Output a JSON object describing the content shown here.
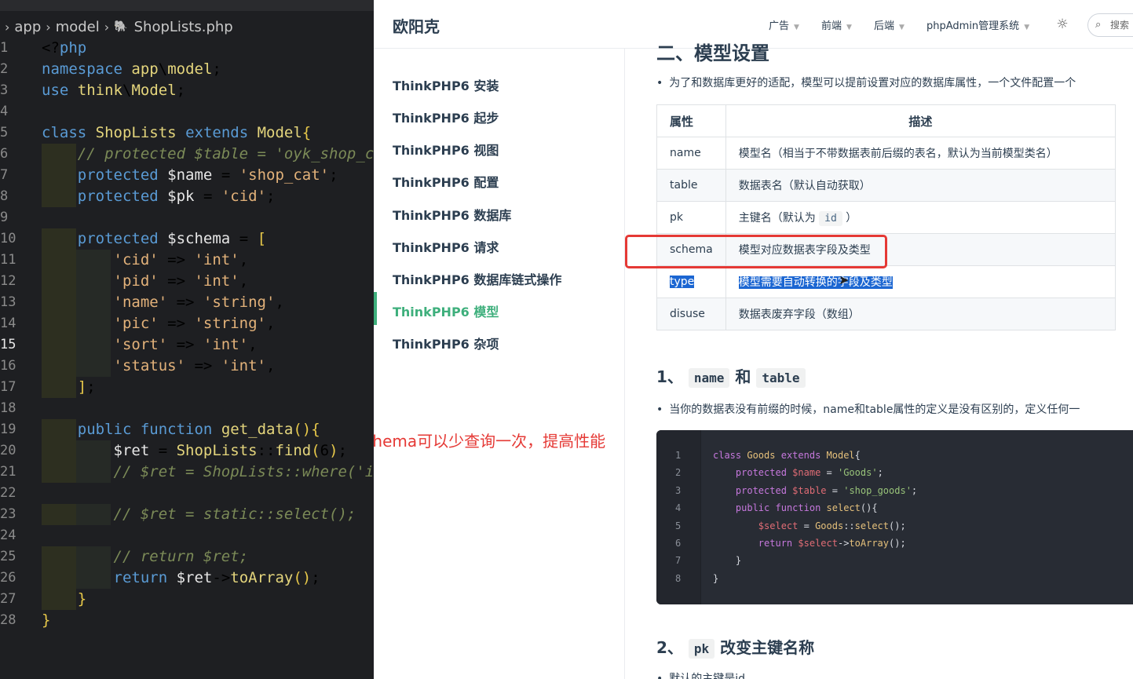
{
  "editor": {
    "breadcrumb": [
      "app",
      "model",
      "ShopLists.php"
    ],
    "active_line": 15,
    "lines": [
      {
        "n": "1",
        "code": "<?php"
      },
      {
        "n": "2",
        "code": "namespace app\\model;"
      },
      {
        "n": "3",
        "code": "use think\\Model;"
      },
      {
        "n": "4",
        "code": ""
      },
      {
        "n": "5",
        "code": "class ShopLists extends Model{"
      },
      {
        "n": "6",
        "code": "    // protected $table = 'oyk_shop_ca"
      },
      {
        "n": "7",
        "code": "    protected $name = 'shop_cat';"
      },
      {
        "n": "8",
        "code": "    protected $pk = 'cid';"
      },
      {
        "n": "9",
        "code": ""
      },
      {
        "n": "10",
        "code": "    protected $schema = ["
      },
      {
        "n": "11",
        "code": "        'cid' => 'int',"
      },
      {
        "n": "12",
        "code": "        'pid' => 'int',"
      },
      {
        "n": "13",
        "code": "        'name' => 'string',"
      },
      {
        "n": "14",
        "code": "        'pic' => 'string',"
      },
      {
        "n": "15",
        "code": "        'sort' => 'int',"
      },
      {
        "n": "16",
        "code": "        'status' => 'int',"
      },
      {
        "n": "17",
        "code": "    ];"
      },
      {
        "n": "18",
        "code": ""
      },
      {
        "n": "19",
        "code": "    public function get_data(){"
      },
      {
        "n": "20",
        "code": "        $ret = ShopLists::find(6);"
      },
      {
        "n": "21",
        "code": "        // $ret = ShopLists::where('id"
      },
      {
        "n": "22",
        "code": ""
      },
      {
        "n": "23",
        "code": "        // $ret = static::select();"
      },
      {
        "n": "24",
        "code": ""
      },
      {
        "n": "25",
        "code": "        // return $ret;"
      },
      {
        "n": "26",
        "code": "        return $ret->toArray();"
      },
      {
        "n": "27",
        "code": "    }"
      },
      {
        "n": "28",
        "code": "}"
      }
    ]
  },
  "site": {
    "title": "欧阳克",
    "nav": [
      "广告",
      "前端",
      "后端",
      "phpAdmin管理系统"
    ],
    "search_placeholder": "搜索"
  },
  "sidebar": {
    "items": [
      {
        "label": "ThinkPHP6 安装",
        "active": false
      },
      {
        "label": "ThinkPHP6 起步",
        "active": false
      },
      {
        "label": "ThinkPHP6 视图",
        "active": false
      },
      {
        "label": "ThinkPHP6 配置",
        "active": false
      },
      {
        "label": "ThinkPHP6 数据库",
        "active": false
      },
      {
        "label": "ThinkPHP6 请求",
        "active": false
      },
      {
        "label": "ThinkPHP6 数据库链式操作",
        "active": false
      },
      {
        "label": "ThinkPHP6 模型",
        "active": true
      },
      {
        "label": "ThinkPHP6 杂项",
        "active": false
      }
    ]
  },
  "annotation": "schema可以少查询一次，提高性能",
  "content": {
    "cut_heading": "二、模型设置",
    "intro": "为了和数据库更好的适配，模型可以提前设置对应的数据库属性，一个文件配置一个",
    "table": {
      "headers": [
        "属性",
        "描述"
      ],
      "rows": [
        {
          "name": "name",
          "desc": "模型名（相当于不带数据表前后缀的表名，默认为当前模型类名）"
        },
        {
          "name": "table",
          "desc": "数据表名（默认自动获取）"
        },
        {
          "name": "pk",
          "desc_before": "主键名（默认为",
          "desc_code": "id",
          "desc_after": "）"
        },
        {
          "name": "schema",
          "desc": "模型对应数据表字段及类型"
        },
        {
          "name": "type",
          "desc": "模型需要自动转换的字段及类型"
        },
        {
          "name": "disuse",
          "desc": "数据表废弃字段（数组）"
        }
      ]
    },
    "section1": {
      "num": "1、",
      "code1": "name",
      "join": "和",
      "code2": "table"
    },
    "section1_text": "当你的数据表没有前缀的时候，name和table属性的定义是没有区别的，定义任何一",
    "code_block": [
      {
        "n": "1",
        "code": "class Goods extends Model{"
      },
      {
        "n": "2",
        "code": "    protected $name = 'Goods';"
      },
      {
        "n": "3",
        "code": "    protected $table = 'shop_goods';"
      },
      {
        "n": "4",
        "code": "    public function select(){"
      },
      {
        "n": "5",
        "code": "        $select = Goods::select();"
      },
      {
        "n": "6",
        "code": "        return $select->toArray();"
      },
      {
        "n": "7",
        "code": "    }"
      },
      {
        "n": "8",
        "code": "}"
      }
    ],
    "section2": {
      "num": "2、",
      "code": "pk",
      "title": "改变主键名称"
    },
    "section2_text": "默认的主键是id"
  }
}
